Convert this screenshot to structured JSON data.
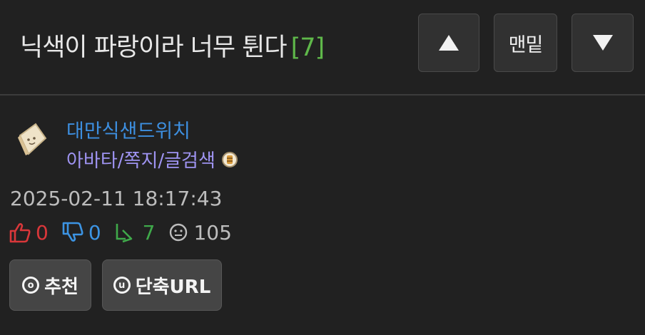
{
  "post": {
    "title": "닉색이 파랑이라 너무 튄다",
    "comment_count_display": "[7]"
  },
  "nav": {
    "bottom_label": "맨밑"
  },
  "author": {
    "name": "대만식샌드위치",
    "links": "아바타/쪽지/글검색"
  },
  "timestamp": "2025-02-11 18:17:43",
  "stats": {
    "upvotes": "0",
    "downvotes": "0",
    "replies": "7",
    "views": "105"
  },
  "actions": {
    "recommend_icon_letter": "o",
    "recommend_label": "추천",
    "shorturl_icon_letter": "u",
    "shorturl_label": "단축URL"
  },
  "colors": {
    "background": "#212121",
    "author_name": "#3d8fe0",
    "author_links": "#9f94f2",
    "upvote": "#d9373a",
    "downvote": "#3c94e3",
    "reply": "#3fa94a",
    "comment_count": "#5fb84a"
  },
  "icons": {
    "up": "triangle-up-icon",
    "down": "triangle-down-icon",
    "upvote": "thumbs-up-icon",
    "downvote": "thumbs-down-icon",
    "reply": "reply-arrow-icon",
    "views": "face-icon",
    "badge": "badge-icon"
  }
}
